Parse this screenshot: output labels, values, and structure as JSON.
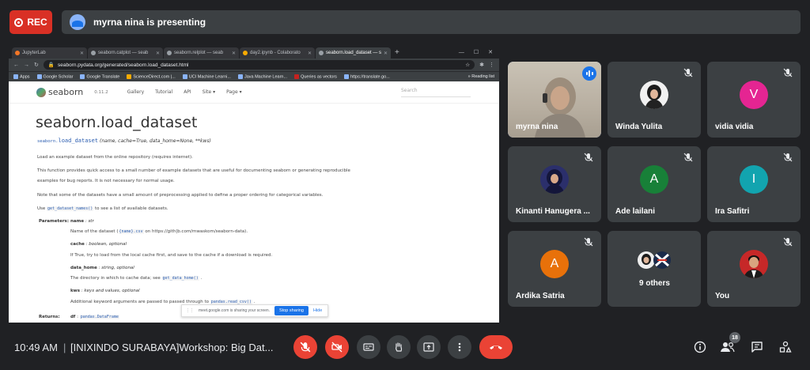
{
  "top": {
    "rec_label": "REC",
    "presenting_text": "myrna nina is presenting"
  },
  "browser": {
    "tabs": [
      {
        "title": "JupyterLab"
      },
      {
        "title": "seaborn.catplot — seab"
      },
      {
        "title": "seaborn.relplot — seab"
      },
      {
        "title": "day2.ipynb - Colaborato"
      },
      {
        "title": "seaborn.load_dataset — s"
      }
    ],
    "url": "seaborn.pydata.org/generated/seaborn.load_dataset.html",
    "bookmarks": [
      "Apps",
      "Google Scholar",
      "Google Translate",
      "ScienceDirect.com |...",
      "UCI Machine Learni...",
      "Java Machine Learn...",
      "Queries as vectors",
      "https://translate.go..."
    ],
    "reading_list": "Reading list"
  },
  "doc": {
    "logo": "seaborn",
    "version": "0.11.2",
    "nav": [
      "Gallery",
      "Tutorial",
      "API",
      "Site ▾",
      "Page ▾"
    ],
    "search_placeholder": "Search",
    "title": "seaborn.load_dataset",
    "sig_module": "seaborn.",
    "sig_func": "load_dataset",
    "sig_params": "(name, cache=True, data_home=None, **kws)",
    "intro": "Load an example dataset from the online repository (requires internet).",
    "para1_line1": "This function provides quick access to a small number of example datasets that are useful for documenting seaborn or generating reproducible",
    "para1_line2": "examples for bug reports. It is not necessary for normal usage.",
    "para2": "Note that some of the datasets have a small amount of preprocessing applied to define a proper ordering for categorical variables.",
    "para3_pre": "Use",
    "para3_code": "get_dataset_names()",
    "para3_post": "to see a list of available datasets.",
    "params_label": "Parameters:",
    "params": [
      {
        "name": "name",
        "type": ": str",
        "desc_pre": "Name of the dataset (",
        "desc_code": "{name}.csv",
        "desc_post": "on https://gith|b.com/mwaskom/seaborn-data)."
      },
      {
        "name": "cache",
        "type": ": boolean, optional",
        "desc_pre": "If True, try to load from the local cache first, and save to the cache if a download is required.",
        "desc_code": "",
        "desc_post": ""
      },
      {
        "name": "data_home",
        "type": ": string, optional",
        "desc_pre": "The directory in which to cache data; see",
        "desc_code": "get_data_home()",
        "desc_post": "."
      },
      {
        "name": "kws",
        "type": ": keys and values, optional",
        "desc_pre": "Additional keyword arguments are passed to passed through to",
        "desc_code": "pandas.read_csv()",
        "desc_post": "."
      }
    ],
    "returns_label": "Returns:",
    "returns_name": "df",
    "returns_type": "pandas.DataFrame",
    "share_notice": "meet.google.com is sharing your screen.",
    "stop_sharing": "Stop sharing",
    "hide": "Hide"
  },
  "participants": [
    {
      "name": "myrna nina",
      "kind": "video"
    },
    {
      "name": "Winda Yulita",
      "kind": "photo"
    },
    {
      "name": "vidia vidia",
      "kind": "letter",
      "letter": "V",
      "color": "#e52592"
    },
    {
      "name": "Kinanti Hanugera ...",
      "kind": "photo"
    },
    {
      "name": "Ade lailani",
      "kind": "letter",
      "letter": "A",
      "color": "#188038"
    },
    {
      "name": "Ira Safitri",
      "kind": "letter",
      "letter": "I",
      "color": "#12a4af"
    },
    {
      "name": "Ardika Satria",
      "kind": "letter",
      "letter": "A",
      "color": "#e8710a"
    },
    {
      "name": "9 others",
      "kind": "group"
    },
    {
      "name": "You",
      "kind": "photo"
    }
  ],
  "bottom": {
    "time": "10:49 AM",
    "separator": "|",
    "meeting_title": "[INIXINDO SURABAYA]Workshop: Big Dat...",
    "people_count": "18"
  },
  "colors": {
    "background": "#202124",
    "tile": "#3c4043",
    "red": "#ea4335",
    "blue": "#1a73e8"
  }
}
